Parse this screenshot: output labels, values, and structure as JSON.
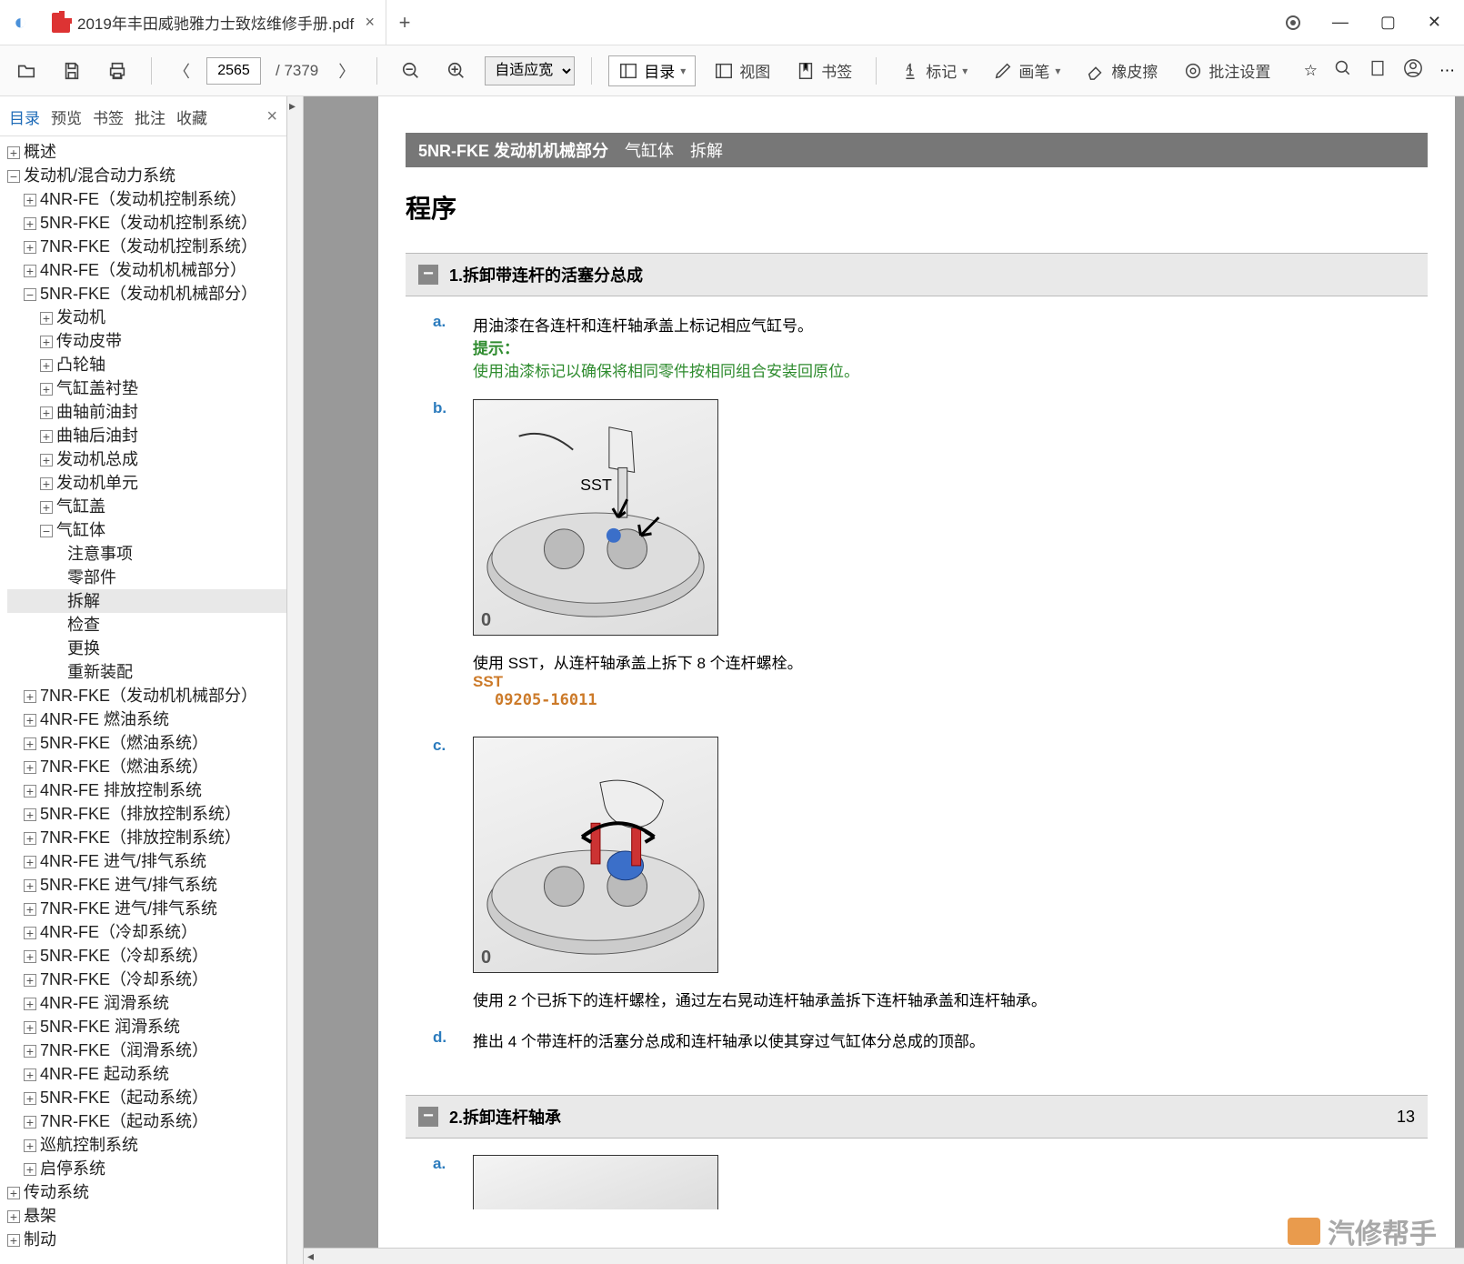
{
  "titlebar": {
    "filename": "2019年丰田威驰雅力士致炫维修手册.pdf"
  },
  "toolbar": {
    "page_current": "2565",
    "page_total": "/ 7379",
    "zoom_mode": "自适应宽",
    "menu_toc": "目录",
    "menu_view": "视图",
    "menu_bookmark": "书签",
    "menu_mark": "标记",
    "menu_draw": "画笔",
    "menu_eraser": "橡皮擦",
    "menu_batch": "批注设置"
  },
  "side_tabs": {
    "t1": "目录",
    "t2": "预览",
    "t3": "书签",
    "t4": "批注",
    "t5": "收藏"
  },
  "tree": {
    "n0": "概述",
    "n1": "发动机/混合动力系统",
    "n1c": [
      "4NR-FE（发动机控制系统）",
      "5NR-FKE（发动机控制系统）",
      "7NR-FKE（发动机控制系统）",
      "4NR-FE（发动机机械部分）",
      "5NR-FKE（发动机机械部分）"
    ],
    "n1c4c": [
      "发动机",
      "传动皮带",
      "凸轮轴",
      "气缸盖衬垫",
      "曲轴前油封",
      "曲轴后油封",
      "发动机总成",
      "发动机单元",
      "气缸盖",
      "气缸体"
    ],
    "n1c4c9c": [
      "注意事项",
      "零部件",
      "拆解",
      "检查",
      "更换",
      "重新装配"
    ],
    "n1d": [
      "7NR-FKE（发动机机械部分）",
      "4NR-FE 燃油系统",
      "5NR-FKE（燃油系统）",
      "7NR-FKE（燃油系统）",
      "4NR-FE 排放控制系统",
      "5NR-FKE（排放控制系统）",
      "7NR-FKE（排放控制系统）",
      "4NR-FE 进气/排气系统",
      "5NR-FKE 进气/排气系统",
      "7NR-FKE 进气/排气系统",
      "4NR-FE（冷却系统）",
      "5NR-FKE（冷却系统）",
      "7NR-FKE（冷却系统）",
      "4NR-FE 润滑系统",
      "5NR-FKE 润滑系统",
      "7NR-FKE（润滑系统）",
      "4NR-FE 起动系统",
      "5NR-FKE（起动系统）",
      "7NR-FKE（起动系统）",
      "巡航控制系统",
      "启停系统"
    ],
    "n2": "传动系统",
    "n3": "悬架",
    "n4": "制动"
  },
  "doc": {
    "breadcrumb_bold": "5NR-FKE 发动机机械部分",
    "breadcrumb_rest": "　气缸体　拆解",
    "section_title": "程序",
    "step1_title": "1.拆卸带连杆的活塞分总成",
    "a_text": "用油漆在各连杆和连杆轴承盖上标记相应气缸号。",
    "hint_label": "提示：",
    "hint_text": "使用油漆标记以确保将相同零件按相同组合安装回原位。",
    "fig_sst_label": "SST",
    "b_text": "使用 SST，从连杆轴承盖上拆下 8 个连杆螺栓。",
    "sst_label": "SST",
    "sst_code": "09205-16011",
    "c_text": "使用 2 个已拆下的连杆螺栓，通过左右晃动连杆轴承盖拆下连杆轴承盖和连杆轴承。",
    "d_text": "推出 4 个带连杆的活塞分总成和连杆轴承以使其穿过气缸体分总成的顶部。",
    "step2_title": "2.拆卸连杆轴承",
    "page_no": "13",
    "watermark": "汽修帮手"
  }
}
